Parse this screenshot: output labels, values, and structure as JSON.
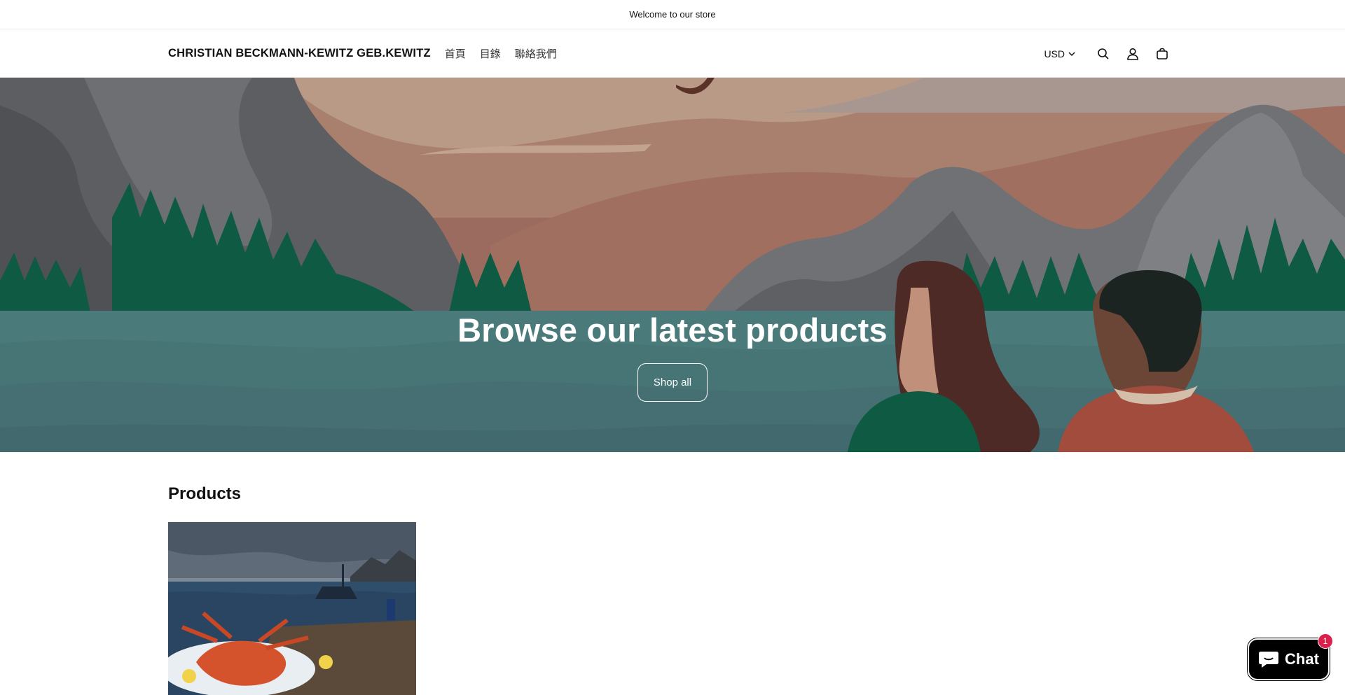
{
  "announcement": {
    "text": "Welcome to our store"
  },
  "header": {
    "logo": "CHRISTIAN BECKMANN-KEWITZ GEB.KEWITZ",
    "nav": [
      {
        "label": "首頁"
      },
      {
        "label": "目錄"
      },
      {
        "label": "聯絡我們"
      }
    ],
    "currency": "USD",
    "icons": [
      "search-icon",
      "account-icon",
      "cart-icon"
    ]
  },
  "hero": {
    "title": "Browse our latest products",
    "button_label": "Shop all"
  },
  "products": {
    "heading": "Products"
  },
  "chat": {
    "label": "Chat",
    "badge": "1"
  },
  "colors": {
    "chat_badge": "#d9214c",
    "water": "#4a7a7a",
    "forest": "#0f5a43"
  }
}
